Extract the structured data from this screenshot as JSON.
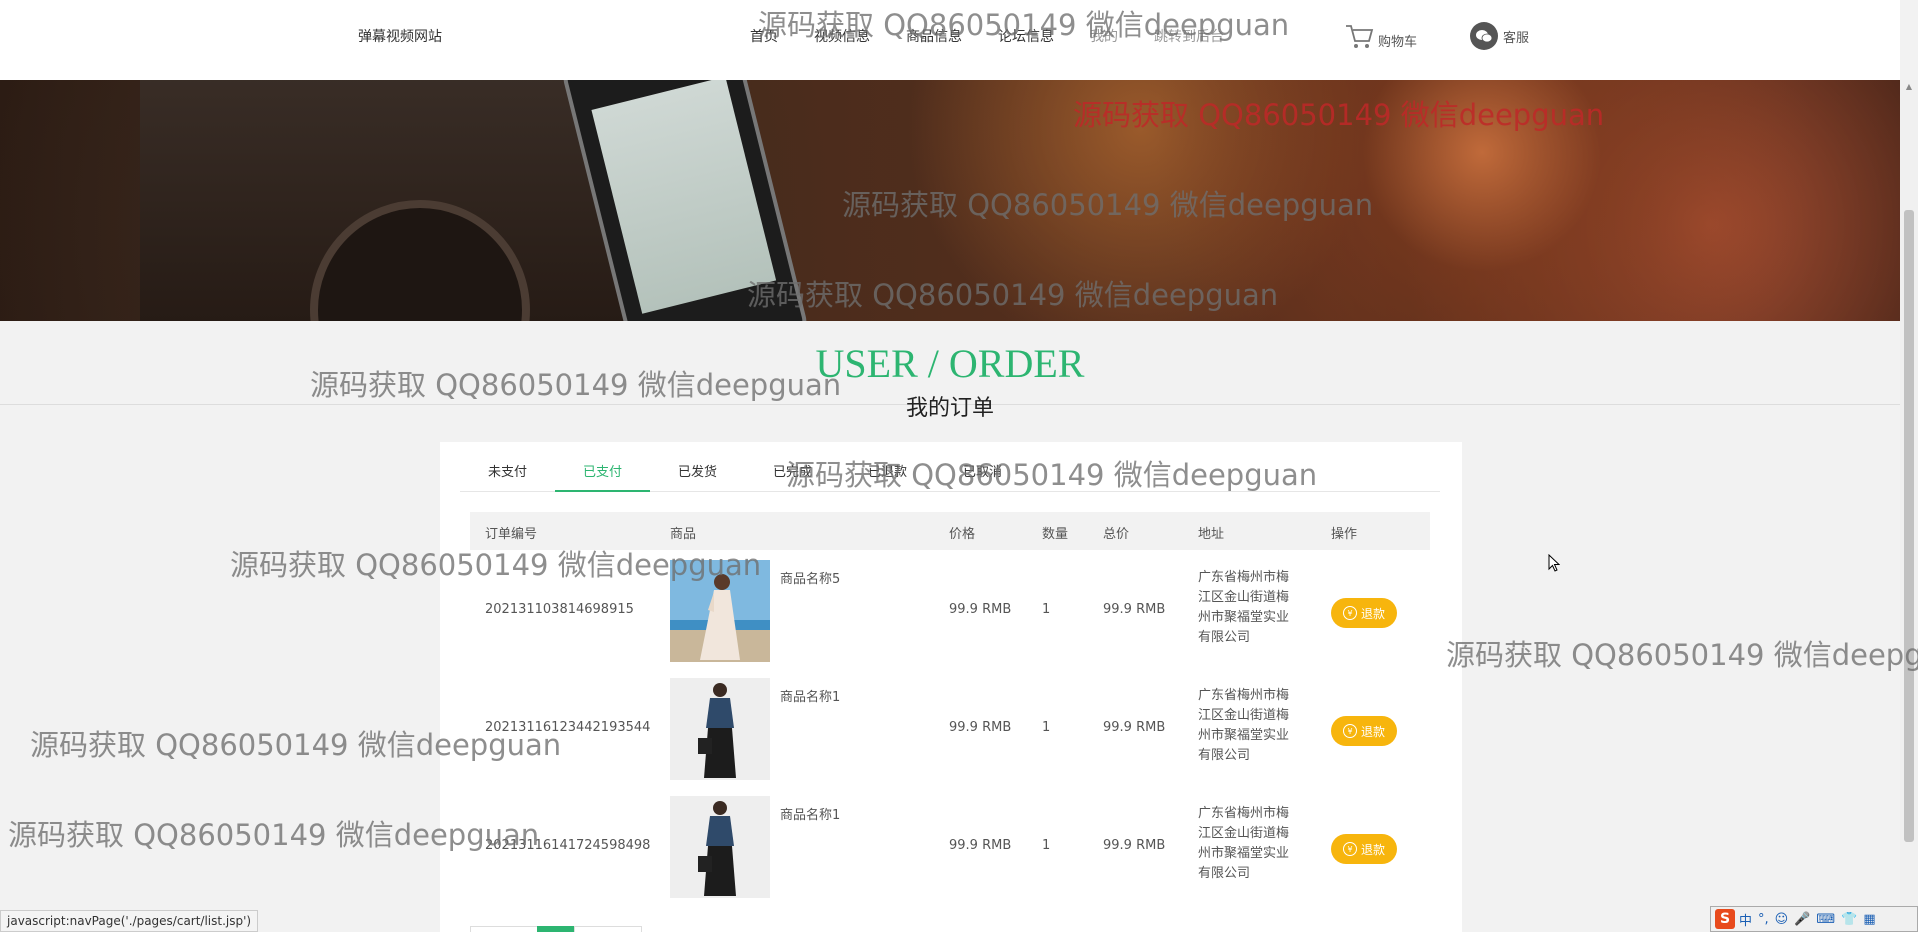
{
  "header": {
    "site_name": "弹幕视频网站",
    "nav": [
      "首页",
      "视频信息",
      "商品信息",
      "论坛信息",
      "我的",
      "跳转到后台"
    ],
    "cart_label": "购物车",
    "service_label": "客服"
  },
  "section": {
    "title": "USER / ORDER",
    "subtitle": "我的订单"
  },
  "tabs": [
    "未支付",
    "已支付",
    "已发货",
    "已完成",
    "已退款",
    "已取消"
  ],
  "active_tab": "已支付",
  "table": {
    "headers": [
      "订单编号",
      "商品",
      "价格",
      "数量",
      "总价",
      "地址",
      "操作"
    ],
    "rows": [
      {
        "order_no": "202131103814698915",
        "product": "商品名称5",
        "price": "99.9 RMB",
        "qty": "1",
        "total": "99.9 RMB",
        "address": "广东省梅州市梅江区金山街道梅州市聚福堂实业有限公司",
        "action": "退款"
      },
      {
        "order_no": "20213116123442193544",
        "product": "商品名称1",
        "price": "99.9 RMB",
        "qty": "1",
        "total": "99.9 RMB",
        "address": "广东省梅州市梅江区金山街道梅州市聚福堂实业有限公司",
        "action": "退款"
      },
      {
        "order_no": "20213116141724598498",
        "product": "商品名称1",
        "price": "99.9 RMB",
        "qty": "1",
        "total": "99.9 RMB",
        "address": "广东省梅州市梅江区金山街道梅州市聚福堂实业有限公司",
        "action": "退款"
      }
    ]
  },
  "watermark": "源码获取 QQ86050149 微信deepguan",
  "status_bar": "javascript:navPage('./pages/cart/list.jsp')",
  "ime": {
    "logo": "S",
    "items": [
      "中",
      "°,",
      "☺",
      "🎤",
      "⌨",
      "👕",
      "▦"
    ]
  },
  "colors": {
    "accent": "#2db571",
    "refund_button": "#f7b50d",
    "watermark_red": "#be2828"
  }
}
